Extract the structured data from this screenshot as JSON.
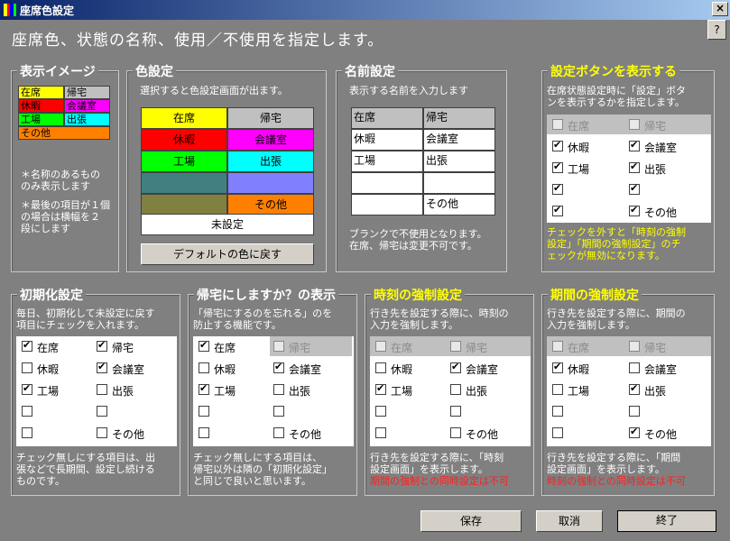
{
  "window": {
    "title": "座席色設定",
    "close": "×",
    "help": "?",
    "heading": "座席色、状態の名称、使用／不使用を指定します。"
  },
  "preview": {
    "title": "表示イメージ",
    "legend": [
      {
        "label": "在席",
        "color": "#ffff00"
      },
      {
        "label": "帰宅",
        "color": "#c0c0c0"
      },
      {
        "label": "休暇",
        "color": "#ff0000"
      },
      {
        "label": "会議室",
        "color": "#ff00ff"
      },
      {
        "label": "工場",
        "color": "#00ff00"
      },
      {
        "label": "出張",
        "color": "#00ffff"
      },
      {
        "label": "その他",
        "color": "#ff8000"
      }
    ],
    "note1": "＊名称のあるもの\nのみ表示します",
    "note2": "＊最後の項目が１個\nの場合は横幅を２\n段にします"
  },
  "colors": {
    "title": "色設定",
    "desc": "選択すると色設定画面が出ます。",
    "cells": [
      {
        "label": "在席",
        "color": "#ffff00",
        "text": "#000"
      },
      {
        "label": "帰宅",
        "color": "#c0c0c0",
        "text": "#000"
      },
      {
        "label": "休暇",
        "color": "#ff0000",
        "text": "#000"
      },
      {
        "label": "会議室",
        "color": "#ff00ff",
        "text": "#000"
      },
      {
        "label": "工場",
        "color": "#00ff00",
        "text": "#000"
      },
      {
        "label": "出張",
        "color": "#00ffff",
        "text": "#000"
      },
      {
        "label": "",
        "color": "#408080",
        "text": "#000"
      },
      {
        "label": "",
        "color": "#8080ff",
        "text": "#000"
      },
      {
        "label": "",
        "color": "#808040",
        "text": "#000"
      },
      {
        "label": "その他",
        "color": "#ff8000",
        "text": "#000"
      }
    ],
    "unset": "未設定",
    "default_btn": "デフォルトの色に戻す"
  },
  "names": {
    "title": "名前設定",
    "desc": "表示する名前を入力します",
    "cells": [
      "在席",
      "帰宅",
      "休暇",
      "会議室",
      "工場",
      "出張",
      "",
      "",
      "",
      "その他"
    ],
    "note": "ブランクで不使用となります。\n在席、帰宅は変更不可です。"
  },
  "show_btn": {
    "title": "設定ボタンを表示する",
    "desc": "在席状態設定時に「設定」ボタ\nンを表示するかを指定します。",
    "items": [
      {
        "label": "在席",
        "on": false,
        "dis": true
      },
      {
        "label": "帰宅",
        "on": false,
        "dis": true
      },
      {
        "label": "休暇",
        "on": true
      },
      {
        "label": "会議室",
        "on": true
      },
      {
        "label": "工場",
        "on": true
      },
      {
        "label": "出張",
        "on": true
      },
      {
        "label": "",
        "on": true
      },
      {
        "label": "",
        "on": true
      },
      {
        "label": "",
        "on": true
      },
      {
        "label": "その他",
        "on": true
      }
    ],
    "note": "チェックを外すと「時刻の強制\n設定」「期間の強制設定」のチ\nェックが無効になります。"
  },
  "init": {
    "title": "初期化設定",
    "desc": "毎日、初期化して未設定に戻す\n項目にチェックを入れます。",
    "items": [
      {
        "label": "在席",
        "on": true
      },
      {
        "label": "帰宅",
        "on": true
      },
      {
        "label": "休暇",
        "on": false
      },
      {
        "label": "会議室",
        "on": true
      },
      {
        "label": "工場",
        "on": true
      },
      {
        "label": "出張",
        "on": false
      },
      {
        "label": "",
        "on": false
      },
      {
        "label": "",
        "on": false
      },
      {
        "label": "",
        "on": false
      },
      {
        "label": "その他",
        "on": false
      }
    ],
    "note": "チェック無しにする項目は、出\n張などで長期間、設定し続ける\nものです。"
  },
  "home": {
    "title": "帰宅にしますか？の表示",
    "desc": "「帰宅にするのを忘れる」のを\n防止する機能です。",
    "items": [
      {
        "label": "在席",
        "on": true
      },
      {
        "label": "帰宅",
        "on": false,
        "dis": true
      },
      {
        "label": "休暇",
        "on": false
      },
      {
        "label": "会議室",
        "on": true
      },
      {
        "label": "工場",
        "on": true
      },
      {
        "label": "出張",
        "on": false
      },
      {
        "label": "",
        "on": false
      },
      {
        "label": "",
        "on": false
      },
      {
        "label": "",
        "on": false
      },
      {
        "label": "その他",
        "on": false
      }
    ],
    "note": "チェック無しにする項目は、\n帰宅以外は隣の「初期化設定」\nと同じで良いと思います。"
  },
  "time": {
    "title": "時刻の強制設定",
    "desc": "行き先を設定する際に、時刻の\n入力を強制します。",
    "items": [
      {
        "label": "在席",
        "on": false,
        "dis": true
      },
      {
        "label": "帰宅",
        "on": false,
        "dis": true
      },
      {
        "label": "休暇",
        "on": false
      },
      {
        "label": "会議室",
        "on": true
      },
      {
        "label": "工場",
        "on": true
      },
      {
        "label": "出張",
        "on": false
      },
      {
        "label": "",
        "on": false
      },
      {
        "label": "",
        "on": false
      },
      {
        "label": "",
        "on": false
      },
      {
        "label": "その他",
        "on": false
      }
    ],
    "note": "行き先を設定する際に、「時刻\n設定画面」を表示します。",
    "warn": "期間の強制との同時設定は不可"
  },
  "period": {
    "title": "期間の強制設定",
    "desc": "行き先を設定する際に、期間の\n入力を強制します。",
    "items": [
      {
        "label": "在席",
        "on": false,
        "dis": true
      },
      {
        "label": "帰宅",
        "on": false,
        "dis": true
      },
      {
        "label": "休暇",
        "on": true
      },
      {
        "label": "会議室",
        "on": false
      },
      {
        "label": "工場",
        "on": false
      },
      {
        "label": "出張",
        "on": true
      },
      {
        "label": "",
        "on": false
      },
      {
        "label": "",
        "on": false
      },
      {
        "label": "",
        "on": false
      },
      {
        "label": "その他",
        "on": true
      }
    ],
    "note": "行き先を設定する際に、「期間\n設定画面」を表示します。",
    "warn": "時刻の強制との同時設定は不可"
  },
  "buttons": {
    "save": "保存",
    "cancel": "取消",
    "exit": "終了"
  }
}
